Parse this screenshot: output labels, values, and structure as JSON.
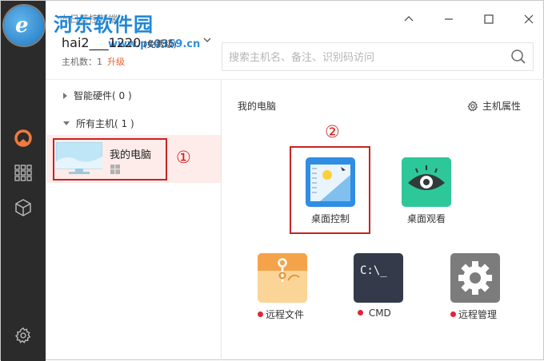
{
  "watermark": {
    "brand": "河东软件园",
    "url": "www.pc0359.cn"
  },
  "account": {
    "hint": "向日葵控制端",
    "name": "hai2___1220",
    "level": "(免费级)",
    "host_count": "主机数：1",
    "upgrade": "升级"
  },
  "search": {
    "placeholder": "搜索主机名、备注、识别码访问"
  },
  "tree": {
    "smart_hardware": "智能硬件( 0 )",
    "all_hosts": "所有主机( 1 )"
  },
  "host": {
    "name": "我的电脑"
  },
  "annotations": {
    "one": "①",
    "two": "②"
  },
  "main": {
    "title": "我的电脑",
    "properties": "主机属性",
    "apps": [
      {
        "label": "桌面控制",
        "color": "#2f8de4"
      },
      {
        "label": "桌面观看",
        "color": "#2ec79a"
      },
      {
        "label": "远程文件",
        "color": "#f5a34b"
      },
      {
        "label": "CMD",
        "color": "#343a49",
        "terminal": "C:\\_"
      },
      {
        "label": "远程管理",
        "color": "#7c7c7c"
      }
    ]
  },
  "colors": {
    "accent": "#e8612c",
    "sidebar": "#2b2b2b",
    "highlight": "#fdecea",
    "annotation": "#c72323"
  }
}
